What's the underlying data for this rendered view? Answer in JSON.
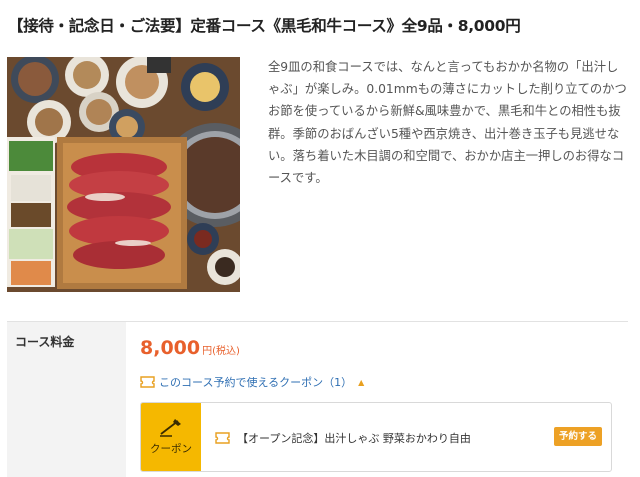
{
  "course": {
    "title": "【接待・記念日・ご法要】定番コース《黒毛和牛コース》全9品・8,000円",
    "description": "全9皿の和食コースでは、なんと言ってもおかか名物の「出汁しゃぶ」が楽しみ。0.01mmもの薄さにカットした削り立てのかつお節を使っているから新鮮&風味豊かで、黒毛和牛との相性も抜群。季節のおばんざい5種や西京焼き、出汁巻き玉子も見逃せない。落ち着いた木目調の和空間で、おかか店主一押しのお得なコースです。"
  },
  "price": {
    "label": "コース料金",
    "amount": "8,000",
    "unit": "円",
    "tax": "(税込)"
  },
  "coupon": {
    "toggle_label": "このコース予約で使えるクーポン（1）",
    "badge_label": "クーポン",
    "item_name": "【オープン記念】出汁しゃぶ 野菜おかわり自由",
    "reserve_label": "予約する"
  },
  "colors": {
    "price": "#e8602c",
    "link": "#2f6fb3",
    "badge": "#f5b800",
    "reserve_button": "#eda125"
  }
}
